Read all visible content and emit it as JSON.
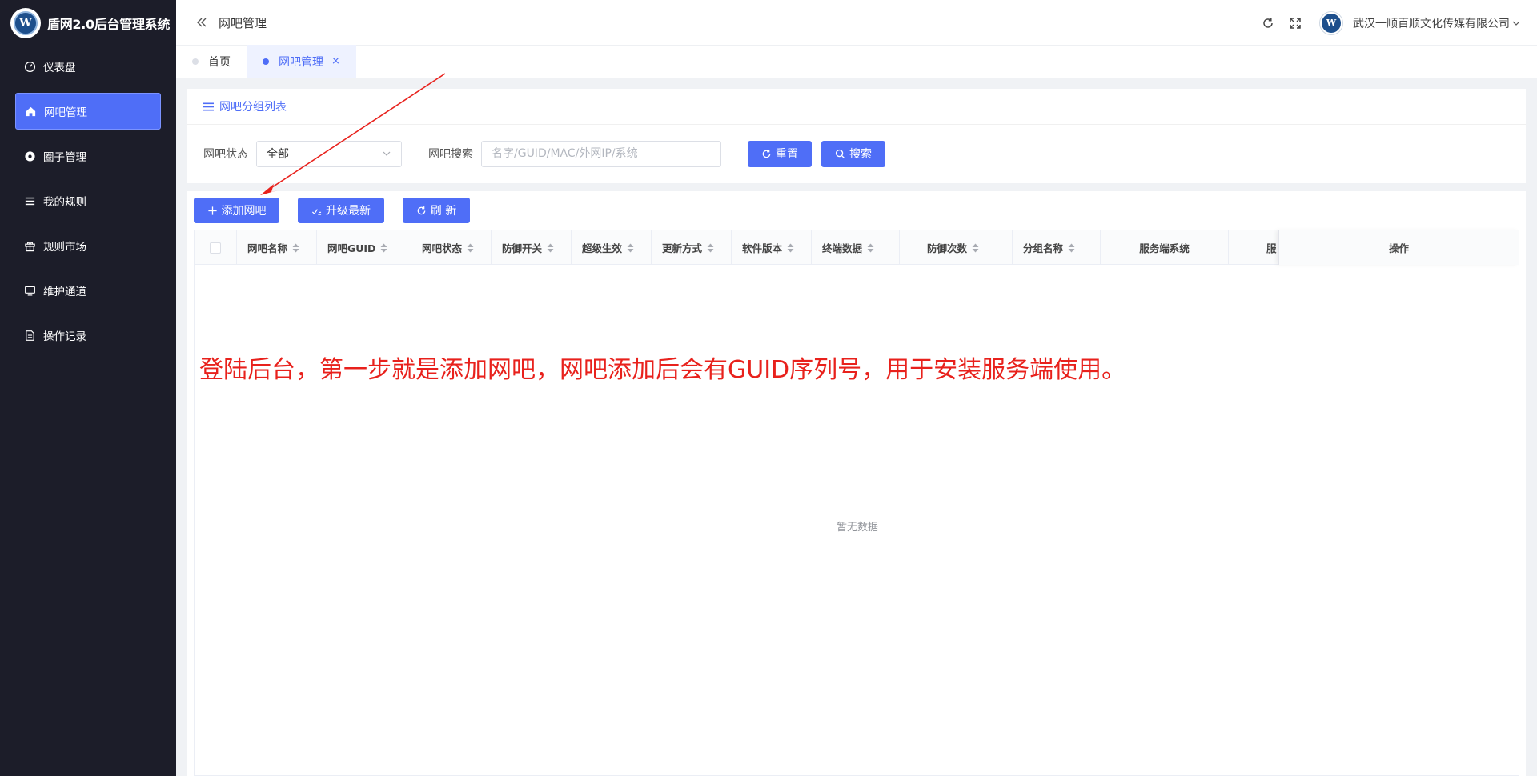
{
  "app": {
    "title": "盾网2.0后台管理系统",
    "logo_letter": "W",
    "accent": "#4f6ef7",
    "sidebar_bg": "#1c1d29"
  },
  "sidebar": {
    "items": [
      {
        "label": "仪表盘",
        "icon": "dashboard-icon",
        "active": false
      },
      {
        "label": "网吧管理",
        "icon": "home-icon",
        "active": true
      },
      {
        "label": "圈子管理",
        "icon": "circle-icon",
        "active": false
      },
      {
        "label": "我的规则",
        "icon": "list-icon",
        "active": false
      },
      {
        "label": "规则市场",
        "icon": "gift-icon",
        "active": false
      },
      {
        "label": "维护通道",
        "icon": "monitor-icon",
        "active": false
      },
      {
        "label": "操作记录",
        "icon": "document-icon",
        "active": false
      }
    ]
  },
  "header": {
    "title": "网吧管理",
    "company": "武汉一顺百顺文化传媒有限公司"
  },
  "tabs": [
    {
      "label": "首页",
      "active": false
    },
    {
      "label": "网吧管理",
      "active": true,
      "close": "×"
    }
  ],
  "filter": {
    "card_title": "网吧分组列表",
    "status_label": "网吧状态",
    "status_value": "全部",
    "search_label": "网吧搜索",
    "search_placeholder": "名字/GUID/MAC/外网IP/系统",
    "reset_label": "重置",
    "search_label_btn": "搜索"
  },
  "toolbar": {
    "add_label": "添加网吧",
    "upgrade_label": "升级最新",
    "refresh_label": "刷 新"
  },
  "table": {
    "columns": [
      "网吧名称",
      "网吧GUID",
      "网吧状态",
      "防御开关",
      "超级生效",
      "更新方式",
      "软件版本",
      "终端数据",
      "防御次数",
      "分组名称",
      "服务端系统",
      "服",
      "操作"
    ],
    "empty_text": "暂无数据"
  },
  "annotation": {
    "text": "登陆后台，第一步就是添加网吧，网吧添加后会有GUID序列号，用于安装服务端使用。",
    "color": "#e8211c"
  }
}
